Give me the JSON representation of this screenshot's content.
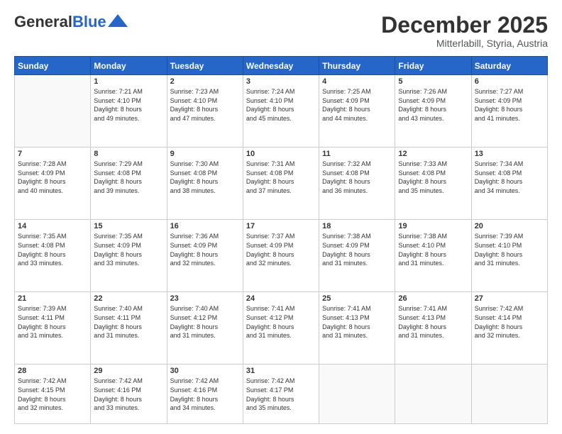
{
  "header": {
    "logo_general": "General",
    "logo_blue": "Blue",
    "month_year": "December 2025",
    "location": "Mitterlabill, Styria, Austria"
  },
  "days_of_week": [
    "Sunday",
    "Monday",
    "Tuesday",
    "Wednesday",
    "Thursday",
    "Friday",
    "Saturday"
  ],
  "weeks": [
    [
      {
        "day": "",
        "info": ""
      },
      {
        "day": "1",
        "info": "Sunrise: 7:21 AM\nSunset: 4:10 PM\nDaylight: 8 hours\nand 49 minutes."
      },
      {
        "day": "2",
        "info": "Sunrise: 7:23 AM\nSunset: 4:10 PM\nDaylight: 8 hours\nand 47 minutes."
      },
      {
        "day": "3",
        "info": "Sunrise: 7:24 AM\nSunset: 4:10 PM\nDaylight: 8 hours\nand 45 minutes."
      },
      {
        "day": "4",
        "info": "Sunrise: 7:25 AM\nSunset: 4:09 PM\nDaylight: 8 hours\nand 44 minutes."
      },
      {
        "day": "5",
        "info": "Sunrise: 7:26 AM\nSunset: 4:09 PM\nDaylight: 8 hours\nand 43 minutes."
      },
      {
        "day": "6",
        "info": "Sunrise: 7:27 AM\nSunset: 4:09 PM\nDaylight: 8 hours\nand 41 minutes."
      }
    ],
    [
      {
        "day": "7",
        "info": "Sunrise: 7:28 AM\nSunset: 4:09 PM\nDaylight: 8 hours\nand 40 minutes."
      },
      {
        "day": "8",
        "info": "Sunrise: 7:29 AM\nSunset: 4:08 PM\nDaylight: 8 hours\nand 39 minutes."
      },
      {
        "day": "9",
        "info": "Sunrise: 7:30 AM\nSunset: 4:08 PM\nDaylight: 8 hours\nand 38 minutes."
      },
      {
        "day": "10",
        "info": "Sunrise: 7:31 AM\nSunset: 4:08 PM\nDaylight: 8 hours\nand 37 minutes."
      },
      {
        "day": "11",
        "info": "Sunrise: 7:32 AM\nSunset: 4:08 PM\nDaylight: 8 hours\nand 36 minutes."
      },
      {
        "day": "12",
        "info": "Sunrise: 7:33 AM\nSunset: 4:08 PM\nDaylight: 8 hours\nand 35 minutes."
      },
      {
        "day": "13",
        "info": "Sunrise: 7:34 AM\nSunset: 4:08 PM\nDaylight: 8 hours\nand 34 minutes."
      }
    ],
    [
      {
        "day": "14",
        "info": "Sunrise: 7:35 AM\nSunset: 4:08 PM\nDaylight: 8 hours\nand 33 minutes."
      },
      {
        "day": "15",
        "info": "Sunrise: 7:35 AM\nSunset: 4:09 PM\nDaylight: 8 hours\nand 33 minutes."
      },
      {
        "day": "16",
        "info": "Sunrise: 7:36 AM\nSunset: 4:09 PM\nDaylight: 8 hours\nand 32 minutes."
      },
      {
        "day": "17",
        "info": "Sunrise: 7:37 AM\nSunset: 4:09 PM\nDaylight: 8 hours\nand 32 minutes."
      },
      {
        "day": "18",
        "info": "Sunrise: 7:38 AM\nSunset: 4:09 PM\nDaylight: 8 hours\nand 31 minutes."
      },
      {
        "day": "19",
        "info": "Sunrise: 7:38 AM\nSunset: 4:10 PM\nDaylight: 8 hours\nand 31 minutes."
      },
      {
        "day": "20",
        "info": "Sunrise: 7:39 AM\nSunset: 4:10 PM\nDaylight: 8 hours\nand 31 minutes."
      }
    ],
    [
      {
        "day": "21",
        "info": "Sunrise: 7:39 AM\nSunset: 4:11 PM\nDaylight: 8 hours\nand 31 minutes."
      },
      {
        "day": "22",
        "info": "Sunrise: 7:40 AM\nSunset: 4:11 PM\nDaylight: 8 hours\nand 31 minutes."
      },
      {
        "day": "23",
        "info": "Sunrise: 7:40 AM\nSunset: 4:12 PM\nDaylight: 8 hours\nand 31 minutes."
      },
      {
        "day": "24",
        "info": "Sunrise: 7:41 AM\nSunset: 4:12 PM\nDaylight: 8 hours\nand 31 minutes."
      },
      {
        "day": "25",
        "info": "Sunrise: 7:41 AM\nSunset: 4:13 PM\nDaylight: 8 hours\nand 31 minutes."
      },
      {
        "day": "26",
        "info": "Sunrise: 7:41 AM\nSunset: 4:13 PM\nDaylight: 8 hours\nand 31 minutes."
      },
      {
        "day": "27",
        "info": "Sunrise: 7:42 AM\nSunset: 4:14 PM\nDaylight: 8 hours\nand 32 minutes."
      }
    ],
    [
      {
        "day": "28",
        "info": "Sunrise: 7:42 AM\nSunset: 4:15 PM\nDaylight: 8 hours\nand 32 minutes."
      },
      {
        "day": "29",
        "info": "Sunrise: 7:42 AM\nSunset: 4:16 PM\nDaylight: 8 hours\nand 33 minutes."
      },
      {
        "day": "30",
        "info": "Sunrise: 7:42 AM\nSunset: 4:16 PM\nDaylight: 8 hours\nand 34 minutes."
      },
      {
        "day": "31",
        "info": "Sunrise: 7:42 AM\nSunset: 4:17 PM\nDaylight: 8 hours\nand 35 minutes."
      },
      {
        "day": "",
        "info": ""
      },
      {
        "day": "",
        "info": ""
      },
      {
        "day": "",
        "info": ""
      }
    ]
  ]
}
